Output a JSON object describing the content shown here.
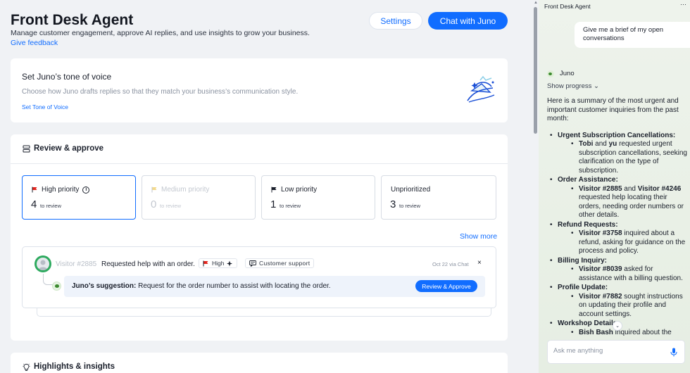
{
  "header": {
    "title": "Front Desk Agent",
    "subtitle": "Manage customer engagement, approve AI replies, and use insights to grow your business.",
    "feedback_link": "Give feedback",
    "settings_label": "Settings",
    "chat_label": "Chat with Juno"
  },
  "tone": {
    "title": "Set Juno’s tone of voice",
    "description": "Choose how Juno drafts replies so that they match your business’s communication style.",
    "link": "Set Tone of Voice"
  },
  "review": {
    "title": "Review & approve",
    "priorities": [
      {
        "label": "High priority",
        "count": "4",
        "note": "to review",
        "flag_color": "#e4231b"
      },
      {
        "label": "Medium priority",
        "count": "0",
        "note": "to review",
        "flag_color": "#f3d98a"
      },
      {
        "label": "Low priority",
        "count": "1",
        "note": "to review",
        "flag_color": "#1a1f2b"
      },
      {
        "label": "Unprioritized",
        "count": "3",
        "note": "to review"
      }
    ],
    "show_more": "Show more",
    "conversation": {
      "visitor": "Visitor #2885",
      "message": "Requested help with an order.",
      "priority_tag": "High",
      "category_tag": "Customer support",
      "date": "Oct 22 via Chat",
      "close": "×",
      "suggestion_label": "Juno’s suggestion:",
      "suggestion_text": "Request for the order number to assist with locating the order.",
      "approve_label": "Review & Approve"
    }
  },
  "insights": {
    "title": "Highlights & insights"
  },
  "panel": {
    "title": "Front Desk Agent",
    "more": "···",
    "user_message": "Give me a brief of my open conversations",
    "assistant_name": "Juno",
    "show_progress": "Show progress ⌄",
    "intro": "Here is a summary of the most urgent and important customer inquiries from the past month:",
    "items": [
      {
        "heading": "Urgent Subscription Cancellations:",
        "parts": [
          [
            "Tobi",
            true
          ],
          [
            " and ",
            false
          ],
          [
            "yu",
            true
          ],
          [
            " requested urgent subscription cancellations, seeking clarification on the type of subscription.",
            false
          ]
        ]
      },
      {
        "heading": "Order Assistance:",
        "parts": [
          [
            "Visitor #2885",
            true
          ],
          [
            " and ",
            false
          ],
          [
            "Visitor #4246",
            true
          ],
          [
            " requested help locating their orders, needing order numbers or other details.",
            false
          ]
        ]
      },
      {
        "heading": "Refund Requests:",
        "parts": [
          [
            "Visitor #3758",
            true
          ],
          [
            " inquired about a refund, asking for guidance on the process and policy.",
            false
          ]
        ]
      },
      {
        "heading": "Billing Inquiry:",
        "parts": [
          [
            "Visitor #8039",
            true
          ],
          [
            " asked for assistance with a billing question.",
            false
          ]
        ]
      },
      {
        "heading": "Profile Update:",
        "parts": [
          [
            "Visitor #7882",
            true
          ],
          [
            " sought instructions on updating their profile and account settings.",
            false
          ]
        ]
      },
      {
        "heading": "Workshop Details:",
        "parts": [
          [
            "Bish Bash",
            true
          ],
          [
            " inquired about the",
            false
          ]
        ]
      }
    ],
    "input_placeholder": "Ask me anything"
  },
  "colors": {
    "accent": "#116dff",
    "high_flag": "#e4231b",
    "juno_green": "#2eaa5f"
  },
  "icons": [
    "tone-illustration-icon",
    "review-icon",
    "flag-icon",
    "info-icon",
    "sparkle-icon",
    "chat-bubble-icon",
    "close-icon",
    "lightbulb-icon",
    "mic-icon",
    "chevron-down-icon"
  ]
}
